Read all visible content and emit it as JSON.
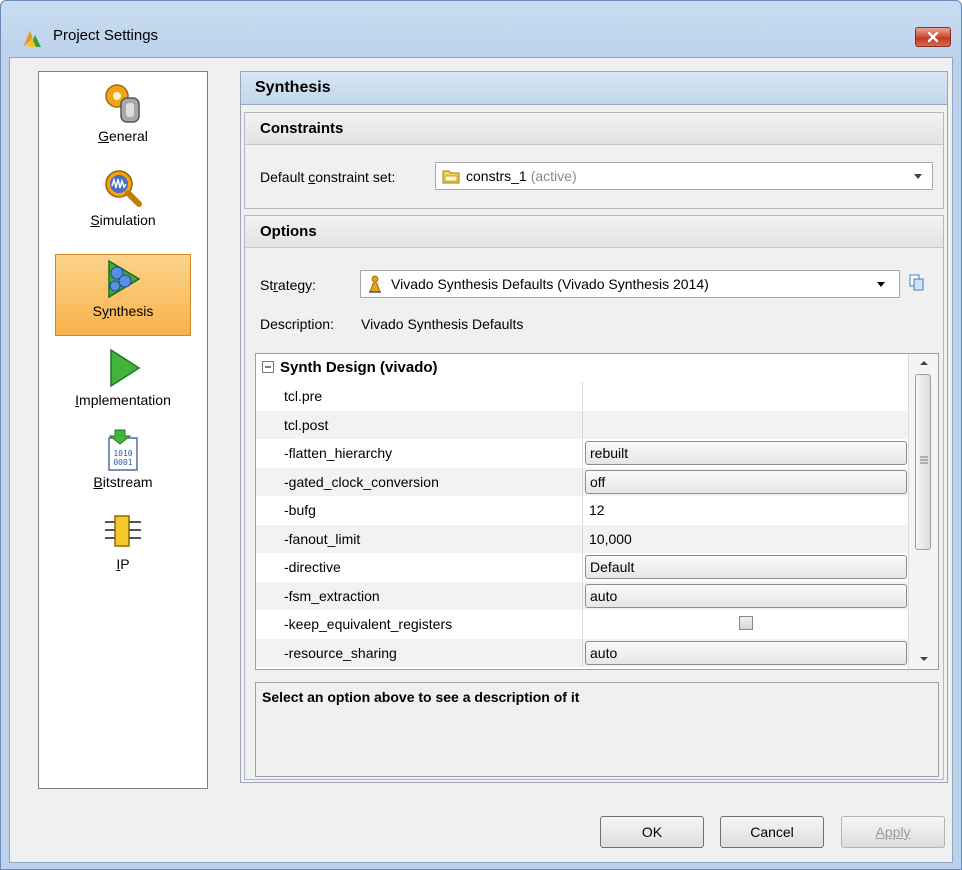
{
  "window": {
    "title": "Project Settings"
  },
  "nav": {
    "items": [
      {
        "id": "general",
        "label": "General",
        "icon": "general-icon",
        "selected": false
      },
      {
        "id": "simulation",
        "label": "Simulation",
        "icon": "simulation-icon",
        "selected": false
      },
      {
        "id": "synthesis",
        "label": "Synthesis",
        "icon": "synthesis-icon",
        "selected": true
      },
      {
        "id": "implementation",
        "label": "Implementation",
        "icon": "implementation-icon",
        "selected": false
      },
      {
        "id": "bitstream",
        "label": "Bitstream",
        "icon": "bitstream-icon",
        "selected": false
      },
      {
        "id": "ip",
        "label": "IP",
        "icon": "ip-icon",
        "selected": false
      }
    ]
  },
  "panel": {
    "title": "Synthesis",
    "constraints": {
      "header": "Constraints",
      "label": "Default constraint set:",
      "value": "constrs_1",
      "status": "(active)"
    },
    "options": {
      "header": "Options",
      "strategy_label": "Strategy:",
      "strategy_value": "Vivado Synthesis Defaults (Vivado Synthesis 2014)",
      "description_label": "Description:",
      "description_value": "Vivado Synthesis Defaults"
    },
    "table": {
      "group": "Synth Design (vivado)",
      "rows": [
        {
          "key": "tcl.pre",
          "value": "",
          "type": "text"
        },
        {
          "key": "tcl.post",
          "value": "",
          "type": "text"
        },
        {
          "key": "-flatten_hierarchy",
          "value": "rebuilt",
          "type": "dropdown"
        },
        {
          "key": "-gated_clock_conversion",
          "value": "off",
          "type": "dropdown"
        },
        {
          "key": "-bufg",
          "value": "12",
          "type": "text"
        },
        {
          "key": "-fanout_limit",
          "value": "10,000",
          "type": "text"
        },
        {
          "key": "-directive",
          "value": "Default",
          "type": "dropdown"
        },
        {
          "key": "-fsm_extraction",
          "value": "auto",
          "type": "dropdown"
        },
        {
          "key": "-keep_equivalent_registers",
          "value": "",
          "type": "checkbox"
        },
        {
          "key": "-resource_sharing",
          "value": "auto",
          "type": "dropdown"
        }
      ]
    },
    "option_description": "Select an option above to see a description of it"
  },
  "buttons": {
    "ok": "OK",
    "cancel": "Cancel",
    "apply": "Apply"
  },
  "colors": {
    "selected_nav": "#f8b24d",
    "header_blue": "#c3d6ec"
  }
}
